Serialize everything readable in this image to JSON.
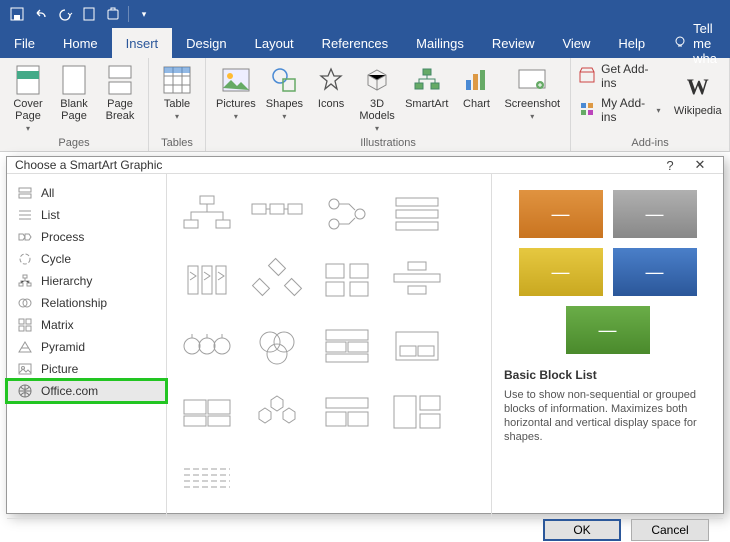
{
  "tabs": {
    "file": "File",
    "home": "Home",
    "insert": "Insert",
    "design": "Design",
    "layout": "Layout",
    "references": "References",
    "mailings": "Mailings",
    "review": "Review",
    "view": "View",
    "help": "Help",
    "tellme": "Tell me wha"
  },
  "ribbon": {
    "pages": {
      "label": "Pages",
      "cover": "Cover\nPage",
      "blank": "Blank\nPage",
      "pbreak": "Page\nBreak"
    },
    "tables": {
      "label": "Tables",
      "table": "Table"
    },
    "illus": {
      "label": "Illustrations",
      "pictures": "Pictures",
      "shapes": "Shapes",
      "icons": "Icons",
      "models": "3D\nModels",
      "smartart": "SmartArt",
      "chart": "Chart",
      "screenshot": "Screenshot"
    },
    "addins": {
      "label": "Add-ins",
      "get": "Get Add-ins",
      "my": "My Add-ins",
      "wiki": "Wikipedia"
    }
  },
  "dialog": {
    "title": "Choose a SmartArt Graphic",
    "categories": [
      "All",
      "List",
      "Process",
      "Cycle",
      "Hierarchy",
      "Relationship",
      "Matrix",
      "Pyramid",
      "Picture",
      "Office.com"
    ],
    "preview": {
      "title": "Basic Block List",
      "desc": "Use to show non-sequential or grouped blocks of information. Maximizes both horizontal and vertical display space for shapes.",
      "colors": [
        "#d9822b",
        "#9e9e9e",
        "#d9b92b",
        "#3a6fb7",
        "#5a9e3c"
      ]
    },
    "ok": "OK",
    "cancel": "Cancel"
  }
}
